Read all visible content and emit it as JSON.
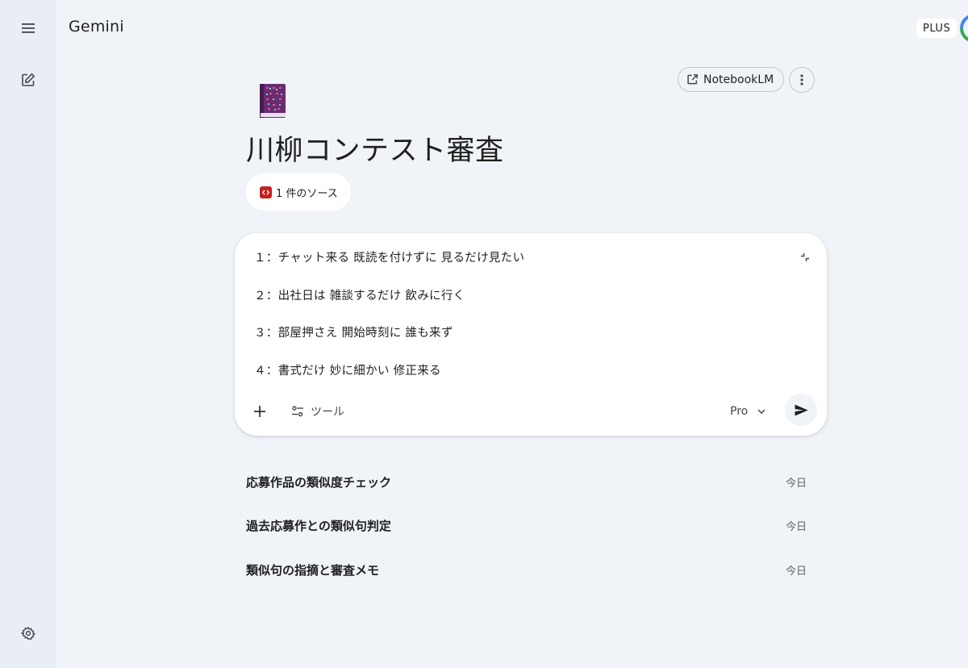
{
  "app": {
    "title": "Gemini",
    "plan_badge": "PLUS"
  },
  "rail": {
    "menu_icon": "menu-icon",
    "new_chat_icon": "edit-icon",
    "settings_icon": "gear-icon"
  },
  "header": {
    "notebook_button": "NotebookLM",
    "notebook_icon": "open-in-new-icon",
    "more_icon": "more-vert-icon"
  },
  "gem": {
    "icon": "book-icon",
    "title": "川柳コンテスト審査",
    "source_chip": "1 件のソース"
  },
  "composer": {
    "lines": [
      "１：チャット来る 既読を付けずに 見るだけ見たい",
      "２：出社日は 雑談するだけ 飲みに行く",
      "３：部屋押さえ 開始時刻に 誰も来ず",
      "４：書式だけ 妙に細かい 修正来る"
    ],
    "tools_label": "ツール",
    "model_label": "Pro",
    "add_icon": "plus-icon",
    "tools_icon": "tune-icon",
    "expand_icon": "collapse-icon",
    "send_icon": "send-icon"
  },
  "history": [
    {
      "title": "応募作品の類似度チェック",
      "date": "今日"
    },
    {
      "title": "過去応募作との類似句判定",
      "date": "今日"
    },
    {
      "title": "類似句の指摘と審査メモ",
      "date": "今日"
    }
  ],
  "colors": {
    "background": "#f0f4f9",
    "rail": "#e9eef6",
    "surface": "#ffffff",
    "source_icon": "#c5221f"
  }
}
